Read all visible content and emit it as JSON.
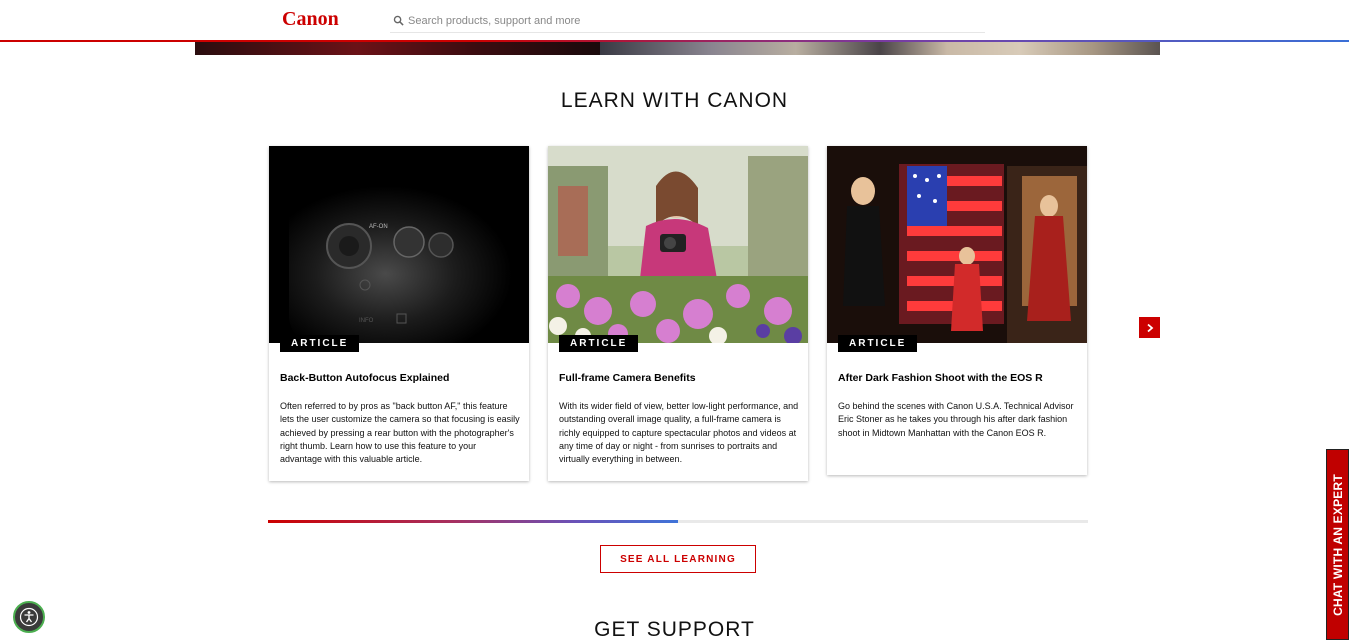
{
  "header": {
    "logo": "Canon",
    "search_placeholder": "Search products, support and more",
    "brand_color": "#cc0000"
  },
  "learn": {
    "title": "LEARN WITH CANON",
    "cards": [
      {
        "badge": "ARTICLE",
        "title": "Back-Button Autofocus Explained",
        "description": "Often referred to by pros as \"back button AF,\" this feature lets the user customize the camera so that focusing is easily achieved by pressing a rear button with the photographer's right thumb.  Learn how to use this feature to your advantage with this valuable article."
      },
      {
        "badge": "ARTICLE",
        "title": "Full-frame Camera Benefits",
        "description": "With its wider field of view, better low-light performance, and outstanding overall image quality, a full-frame camera is richly equipped to capture spectacular photos and videos at any time of day or night - from sunrises to portraits and virtually everything in between."
      },
      {
        "badge": "ARTICLE",
        "title": "After Dark Fashion Shoot with the EOS R",
        "description": "Go behind the scenes with Canon U.S.A. Technical Advisor Eric Stoner as he takes you through his after dark fashion shoot in Midtown Manhattan with the Canon EOS R."
      }
    ],
    "carousel_progress": 0.5,
    "see_all_label": "SEE ALL LEARNING",
    "next_icon": "chevron-right-icon"
  },
  "support": {
    "title": "GET SUPPORT"
  },
  "chat": {
    "label": "CHAT WITH AN EXPERT"
  },
  "accessibility": {
    "icon": "accessibility-icon"
  }
}
